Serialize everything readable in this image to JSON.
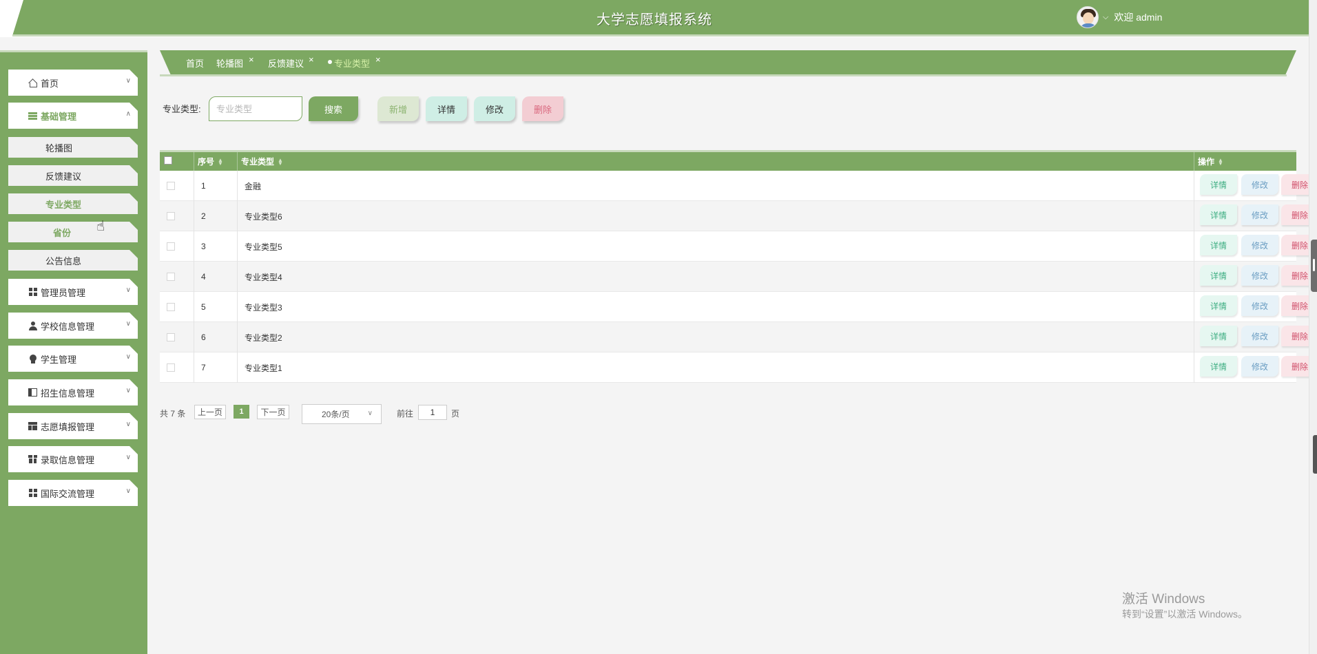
{
  "app": {
    "title": "大学志愿填报系统",
    "welcome": "欢迎 admin"
  },
  "sidebar": {
    "items": [
      {
        "label": "首页",
        "icon": "home-icon"
      },
      {
        "label": "基础管理",
        "icon": "list-icon",
        "expanded": true,
        "children": [
          "轮播图",
          "反馈建议",
          "专业类型",
          "省份",
          "公告信息"
        ]
      },
      {
        "label": "管理员管理",
        "icon": "grid-icon"
      },
      {
        "label": "学校信息管理",
        "icon": "user-icon"
      },
      {
        "label": "学生管理",
        "icon": "badge-icon"
      },
      {
        "label": "招生信息管理",
        "icon": "panel-icon"
      },
      {
        "label": "志愿填报管理",
        "icon": "layout-icon"
      },
      {
        "label": "录取信息管理",
        "icon": "gift-icon"
      },
      {
        "label": "国际交流管理",
        "icon": "grid-icon"
      }
    ]
  },
  "tabs": [
    {
      "label": "首页",
      "closable": false
    },
    {
      "label": "轮播图",
      "closable": true
    },
    {
      "label": "反馈建议",
      "closable": true
    },
    {
      "label": "专业类型",
      "closable": true,
      "current": true
    }
  ],
  "tab_close_glyph": "×",
  "search": {
    "label": "专业类型:",
    "placeholder": "专业类型",
    "button": "搜索"
  },
  "toolbar": {
    "add": "新增",
    "detail": "详情",
    "edit": "修改",
    "delete": "删除"
  },
  "table": {
    "columns": [
      "序号",
      "专业类型",
      "操作"
    ],
    "rows": [
      {
        "index": "1",
        "type": "金融"
      },
      {
        "index": "2",
        "type": "专业类型6"
      },
      {
        "index": "3",
        "type": "专业类型5"
      },
      {
        "index": "4",
        "type": "专业类型4"
      },
      {
        "index": "5",
        "type": "专业类型3"
      },
      {
        "index": "6",
        "type": "专业类型2"
      },
      {
        "index": "7",
        "type": "专业类型1"
      }
    ],
    "row_actions": {
      "detail": "详情",
      "edit": "修改",
      "delete": "删除"
    }
  },
  "pagination": {
    "total": "共 7 条",
    "prev": "上一页",
    "current": "1",
    "next": "下一页",
    "page_size": "20条/页",
    "goto": "前往",
    "goto_value": "1",
    "unit": "页"
  },
  "watermark": {
    "line1": "激活 Windows",
    "line2": "转到“设置”以激活 Windows。"
  },
  "colors": {
    "primary": "#7da862",
    "light_line": "#c7d9bb",
    "danger": "#d9677e",
    "info": "#6a9dc2",
    "success": "#3fae82"
  }
}
